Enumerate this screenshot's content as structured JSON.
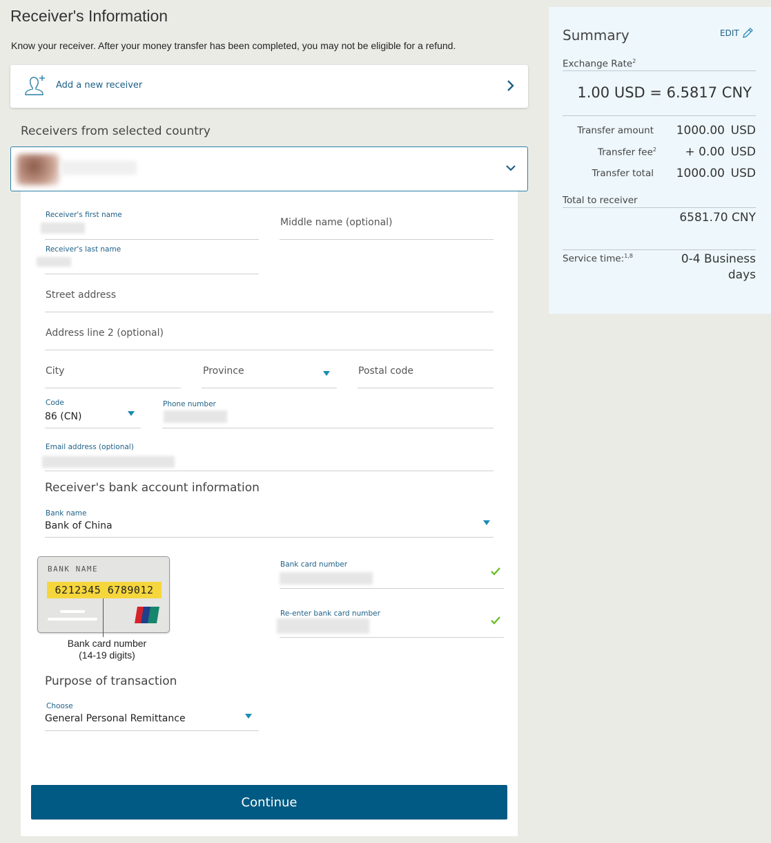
{
  "page": {
    "title": "Receiver's Information",
    "notice": "Know your receiver. After your money transfer has been completed, you may not be eligible for a refund."
  },
  "add_receiver": {
    "label": "Add a new receiver"
  },
  "receivers_section": {
    "title": "Receivers from selected country"
  },
  "form": {
    "first_name_label": "Receiver's first name",
    "middle_name_placeholder": "Middle name (optional)",
    "last_name_label": "Receiver's last name",
    "street_placeholder": "Street address",
    "address2_placeholder": "Address line 2 (optional)",
    "city_placeholder": "City",
    "province_placeholder": "Province",
    "postal_placeholder": "Postal code",
    "code_label": "Code",
    "code_value": "86 (CN)",
    "phone_label": "Phone number",
    "email_label": "Email address (optional)"
  },
  "bank": {
    "section_title": "Receiver's bank account information",
    "bank_name_label": "Bank name",
    "bank_name_value": "Bank of China",
    "card_number_label": "Bank card number",
    "reenter_label": "Re-enter bank card number",
    "card_image": {
      "bank_name": "BANK NAME",
      "number": "6212345 6789012",
      "caption_line1": "Bank card number",
      "caption_line2": "(14-19 digits)"
    }
  },
  "purpose": {
    "section_title": "Purpose of transaction",
    "choose_label": "Choose",
    "value": "General Personal Remittance"
  },
  "continue_label": "Continue",
  "summary": {
    "title": "Summary",
    "edit": "EDIT",
    "exchange_rate_label": "Exchange Rate",
    "exchange_rate_sup": "2",
    "exchange_rate_value": "1.00 USD = 6.5817 CNY",
    "transfer_amount_label": "Transfer amount",
    "transfer_amount_value": "1000.00",
    "transfer_amount_cur": "USD",
    "transfer_fee_label": "Transfer fee",
    "transfer_fee_sup": "2",
    "transfer_fee_value": "+ 0.00",
    "transfer_fee_cur": "USD",
    "transfer_total_label": "Transfer total",
    "transfer_total_value": "1000.00",
    "transfer_total_cur": "USD",
    "total_receiver_label": "Total to receiver",
    "total_receiver_value": "6581.70 CNY",
    "service_time_label": "Service time:",
    "service_time_sup": "1,8",
    "service_time_value_line1": "0-4 Business",
    "service_time_value_line2": "days"
  },
  "colors": {
    "accent": "#005a83",
    "link": "#1d5f86",
    "dropdown_arrow": "#1b8ab5",
    "check": "#6abf2e",
    "summary_bg": "#eef7fb",
    "page_bg": "#ebebe6"
  },
  "icons": {
    "add_person": "add-person-icon",
    "chevron_right": "chevron-right-icon",
    "chevron_down": "chevron-down-icon",
    "pencil": "pencil-icon",
    "check": "checkmark-icon",
    "unionpay": "unionpay-logo"
  }
}
